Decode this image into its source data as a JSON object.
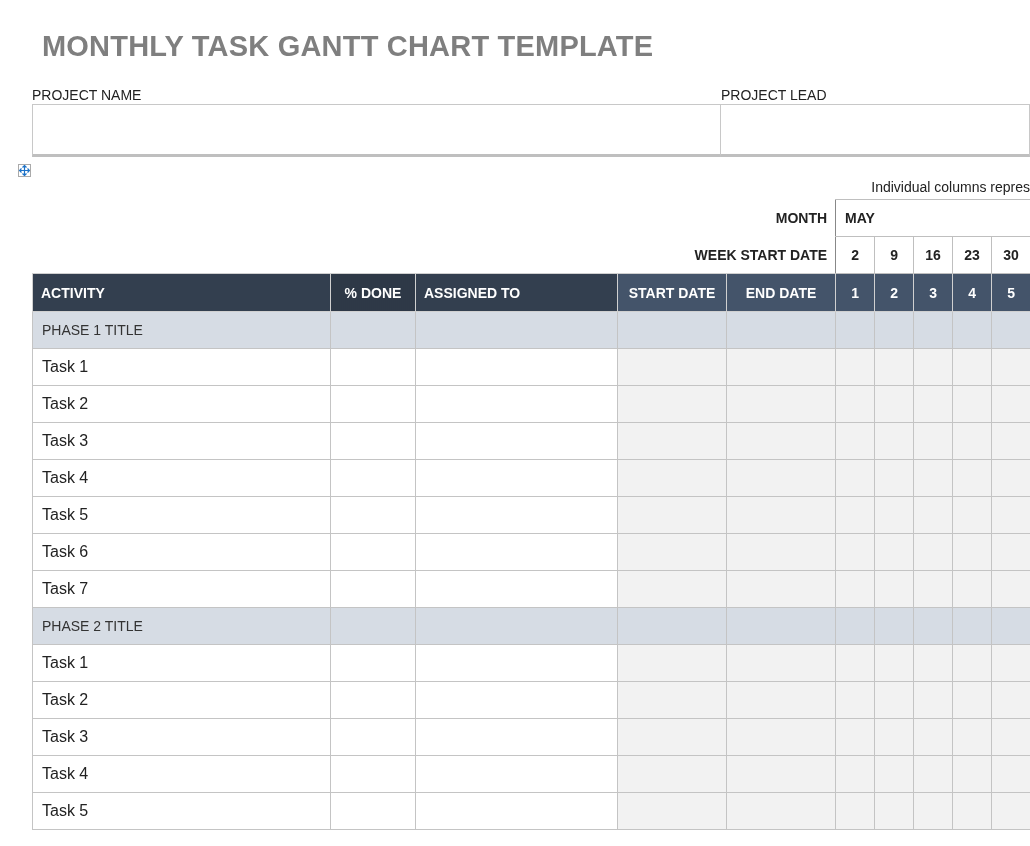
{
  "title": "MONTHLY TASK GANTT CHART TEMPLATE",
  "project_fields": [
    {
      "label": "PROJECT NAME"
    },
    {
      "label": "PROJECT LEAD"
    }
  ],
  "note": "Individual columns repres",
  "month": {
    "label": "MONTH",
    "value": "MAY"
  },
  "week_start": {
    "label": "WEEK START DATE",
    "dates": [
      "2",
      "9",
      "16",
      "23",
      "30"
    ]
  },
  "table": {
    "columns": [
      "ACTIVITY",
      "% DONE",
      "ASSIGNED TO",
      "START DATE",
      "END DATE"
    ],
    "week_numbers": [
      "1",
      "2",
      "3",
      "4",
      "5"
    ],
    "rows": [
      {
        "kind": "phase",
        "label": "PHASE 1 TITLE"
      },
      {
        "kind": "task",
        "label": "Task 1"
      },
      {
        "kind": "task",
        "label": "Task 2"
      },
      {
        "kind": "task",
        "label": "Task 3"
      },
      {
        "kind": "task",
        "label": "Task 4"
      },
      {
        "kind": "task",
        "label": "Task 5"
      },
      {
        "kind": "task",
        "label": "Task 6"
      },
      {
        "kind": "task",
        "label": "Task 7"
      },
      {
        "kind": "phase",
        "label": "PHASE 2 TITLE"
      },
      {
        "kind": "task",
        "label": "Task 1"
      },
      {
        "kind": "task",
        "label": "Task 2"
      },
      {
        "kind": "task",
        "label": "Task 3"
      },
      {
        "kind": "task",
        "label": "Task 4"
      },
      {
        "kind": "task",
        "label": "Task 5"
      }
    ]
  }
}
